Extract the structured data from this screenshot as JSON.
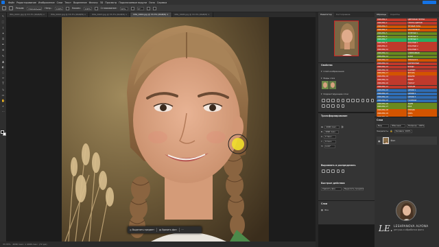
{
  "menu": [
    "Файл",
    "Редактирование",
    "Изображение",
    "Слои",
    "Текст",
    "Выделение",
    "Фильтр",
    "3D",
    "Просмотр",
    "Подключаемые модули",
    "Окно",
    "Справка"
  ],
  "share_label": "",
  "options": {
    "mode_label": "Режим:",
    "mode_value": "Нормальный",
    "opacity_label": "Непр.:",
    "opacity_value": "100%",
    "flow_label": "Нажим:",
    "flow_value": "100%",
    "smooth_label": "Сглаживание:",
    "smooth_value": "10%",
    "angle_value": "0°"
  },
  "tabs": [
    {
      "label": "IMG_0001.jpg @ 33.3% (RGB/8) ×"
    },
    {
      "label": "IMG_0002.jpg @ 33.3% (RGB/8) ×"
    },
    {
      "label": "IMG_0003.jpg @ 33.3% (RGB/8) ×"
    },
    {
      "label": "IMG_0004.jpg @ 33.3% (RGB/8) ×"
    },
    {
      "label": "IMG_0005.jpg @ 33.3% (RGB/8) ×"
    }
  ],
  "tools": [
    "↖",
    "⬚",
    "⌇",
    "✦",
    "⌗",
    "✒",
    "⊕",
    "✎",
    "▲",
    "◐",
    "◌",
    "✑",
    "T",
    "↳",
    "▭",
    "✋",
    "⌕",
    "⋯"
  ],
  "context_bar": {
    "select_subject": "Выделить предмет",
    "remove_bg": "Удалить фон",
    "more": "···"
  },
  "status": {
    "zoom": "33.33%",
    "doc": "4096 пикс. x 4096 пикс. (72 ppi)"
  },
  "navigator": {
    "tab1": "Навигатор",
    "tab2": "Гистограмма",
    "zoom": "33.33%"
  },
  "properties": {
    "title": "Свойства",
    "section1": "Слой изображения",
    "section2": "Виды слоя",
    "section3": "Корректирующие слои",
    "transform": "Трансформирование",
    "w_label": "Ш",
    "w_value": "4096 пикс.",
    "h_label": "В",
    "h_value": "4096 пикс.",
    "x_label": "X",
    "x_value": "0 пикс.",
    "y_label": "Y",
    "y_value": "0 пикс.",
    "angle": "0,00°",
    "align": "Выровнять и распределить",
    "quick": "Быстрые действия",
    "q1": "Удалить фон",
    "q2": "Выделить предмет"
  },
  "swatches": {
    "tab1": "Образцы",
    "tab2": "Скрипты",
    "rows": [
      {
        "colors": [
          "#c0392b",
          "#c0392b"
        ],
        "labels": [
          "ОБРАЗЕЦ 1",
          "ЦВЕТОВАЯ ГРУППА"
        ]
      },
      {
        "colors": [
          "#c0392b",
          "#c0392b"
        ],
        "labels": [
          "ОБРАЗЕЦ 2",
          "ГРУППА ЦВЕТОВ"
        ]
      },
      {
        "colors": [
          "#d35400",
          "#d35400"
        ],
        "labels": [
          "ОБРАЗЕЦ 3",
          "ТЕПЛЫЕ ТОНА"
        ]
      },
      {
        "colors": [
          "#d35400",
          "#d35400"
        ],
        "labels": [
          "ОБРАЗЕЦ 4",
          "ОРАНЖЕВЫЙ"
        ]
      },
      {
        "colors": [
          "#6a8a1f",
          "#6a8a1f"
        ],
        "labels": [
          "ОБРАЗЕЦ 5",
          "ЗЕЛЕНЫЙ 1"
        ]
      },
      {
        "colors": [
          "#6a8a1f",
          "#6a8a1f"
        ],
        "labels": [
          "ОБРАЗЕЦ 6",
          "ЗЕЛЕНЫЙ 2"
        ]
      },
      {
        "colors": [
          "#27ae60",
          "#27ae60"
        ],
        "labels": [
          "ОБРАЗЕЦ 7",
          "ЗЕЛЕНЫЙ 3"
        ]
      },
      {
        "colors": [
          "#c0392b",
          "#c0392b"
        ],
        "labels": [
          "ОБРАЗЕЦ 8",
          "КРАСНЫЙ 1"
        ]
      },
      {
        "colors": [
          "#c0392b",
          "#c0392b"
        ],
        "labels": [
          "ОБРАЗЕЦ 9",
          "КРАСНЫЙ 2"
        ]
      },
      {
        "colors": [
          "#c0392b",
          "#c0392b"
        ],
        "labels": [
          "ОБРАЗЕЦ 10",
          "КРАСНЫЙ 3"
        ]
      },
      {
        "colors": [
          "#6a8a1f",
          "#6a8a1f"
        ],
        "labels": [
          "ОБРАЗЕЦ 11",
          "ОЛИВКОВЫЙ"
        ]
      },
      {
        "colors": [
          "#6a8a1f",
          "#6a8a1f"
        ],
        "labels": [
          "ОБРАЗЕЦ 12",
          "ХАКИ"
        ]
      },
      {
        "colors": [
          "#d35400",
          "#d35400"
        ],
        "labels": [
          "ОБРАЗЕЦ 13",
          "ТЕРРАКОТА"
        ]
      },
      {
        "colors": [
          "#c0392b",
          "#c0392b"
        ],
        "labels": [
          "ОБРАЗЕЦ 14",
          "КИРПИЧНЫЙ"
        ]
      },
      {
        "colors": [
          "#c0392b",
          "#c0392b"
        ],
        "labels": [
          "ОБРАЗЕЦ 15",
          "БОРДО"
        ]
      },
      {
        "colors": [
          "#c0392b",
          "#c0392b"
        ],
        "labels": [
          "ОБРАЗЕЦ 16",
          "КАРМИН"
        ]
      },
      {
        "colors": [
          "#d35400",
          "#d35400"
        ],
        "labels": [
          "ОБРАЗЕЦ 17",
          "ЯНТАРЬ"
        ]
      },
      {
        "colors": [
          "#c0392b",
          "#c0392b"
        ],
        "labels": [
          "ОБРАЗЕЦ 18",
          "ВИШНЯ"
        ]
      },
      {
        "colors": [
          "#c0392b",
          "#c0392b"
        ],
        "labels": [
          "ОБРАЗЕЦ 19",
          "РУБИН"
        ]
      },
      {
        "colors": [
          "#c0392b",
          "#c0392b"
        ],
        "labels": [
          "ОБРАЗЕЦ 20",
          "ГРАНАТ"
        ]
      },
      {
        "colors": [
          "#c0392b",
          "#c0392b"
        ],
        "labels": [
          "ОБРАЗЕЦ 21",
          "КОРАЛЛ"
        ]
      },
      {
        "colors": [
          "#2f6db5",
          "#2f6db5"
        ],
        "labels": [
          "ОБРАЗЕЦ 22",
          "СИНИЙ 1"
        ]
      },
      {
        "colors": [
          "#2f6db5",
          "#2f6db5"
        ],
        "labels": [
          "ОБРАЗЕЦ 23",
          "СИНИЙ 2"
        ]
      },
      {
        "colors": [
          "#2f6db5",
          "#2f6db5"
        ],
        "labels": [
          "ОБРАЗЕЦ 24",
          "СИНИЙ 3"
        ]
      },
      {
        "colors": [
          "#2f6db5",
          "#2f6db5"
        ],
        "labels": [
          "ОБРАЗЕЦ 25",
          "ГОЛУБОЙ"
        ]
      },
      {
        "colors": [
          "#6a8a1f",
          "#6a8a1f"
        ],
        "labels": [
          "ОБРАЗЕЦ 26",
          "ЛАЙМ"
        ]
      },
      {
        "colors": [
          "#6a8a1f",
          "#6a8a1f"
        ],
        "labels": [
          "ОБРАЗЕЦ 27",
          "МОХ"
        ]
      },
      {
        "colors": [
          "#d35400",
          "#d35400"
        ],
        "labels": [
          "ОБРАЗЕЦ 28",
          "ПЕРСИК"
        ]
      },
      {
        "colors": [
          "#d35400",
          "#d35400"
        ],
        "labels": [
          "ОБРАЗЕЦ 29",
          "ОХРА"
        ]
      },
      {
        "colors": [
          "#d35400",
          "#d35400"
        ],
        "labels": [
          "ОБРАЗЕЦ 30",
          "МЕДЬ"
        ]
      }
    ]
  },
  "layers": {
    "title": "Слои",
    "kind": "Вид",
    "mode": "Обычные",
    "opacity": "Непрозр.: 100%",
    "fill": "Заливка: 100%",
    "lock": "Закрепить:",
    "layer_name": "Фон"
  },
  "brand": {
    "logo": "LE.",
    "name": "LESHPANOVA ALYONA",
    "subtitle": "ретушь и обработка фото"
  }
}
